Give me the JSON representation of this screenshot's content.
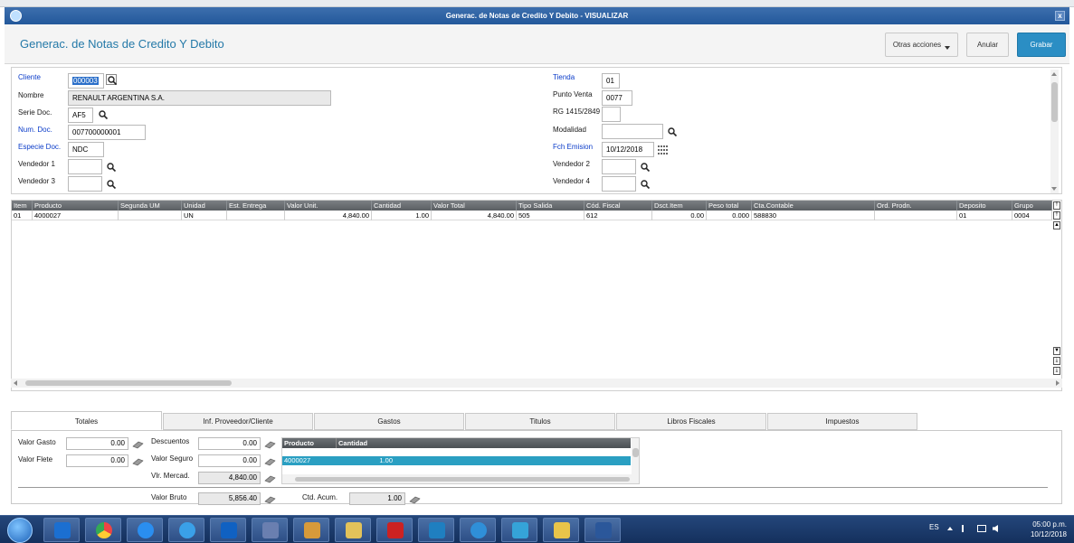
{
  "window": {
    "title": "Generac. de Notas de Credito Y Debito - VISUALIZAR",
    "close_label": "x"
  },
  "header": {
    "title": "Generac. de Notas de Credito Y Debito",
    "otras_acciones": "Otras acciones",
    "anular": "Anular",
    "grabar": "Grabar"
  },
  "form": {
    "cliente": {
      "label": "Cliente",
      "value": "000003"
    },
    "nombre": {
      "label": "Nombre",
      "value": "RENAULT ARGENTINA S.A."
    },
    "serie_doc": {
      "label": "Serie Doc.",
      "value": "AF5"
    },
    "num_doc": {
      "label": "Num. Doc.",
      "value": "007700000001"
    },
    "especie_doc": {
      "label": "Especie Doc.",
      "value": "NDC"
    },
    "vendedor1": {
      "label": "Vendedor 1",
      "value": ""
    },
    "vendedor3": {
      "label": "Vendedor 3",
      "value": ""
    },
    "tienda": {
      "label": "Tienda",
      "value": "01"
    },
    "punto_venta": {
      "label": "Punto Venta",
      "value": "0077"
    },
    "rg": {
      "label": "RG 1415/2849",
      "value": ""
    },
    "modalidad": {
      "label": "Modalidad",
      "value": ""
    },
    "fch_emision": {
      "label": "Fch Emision",
      "value": "10/12/2018"
    },
    "vendedor2": {
      "label": "Vendedor 2",
      "value": ""
    },
    "vendedor4": {
      "label": "Vendedor 4",
      "value": ""
    }
  },
  "grid": {
    "columns": [
      "Item",
      "Producto",
      "Segunda UM",
      "Unidad",
      "Est. Entrega",
      "Valor Unit.",
      "Cantidad",
      "Valor Total",
      "Tipo Salida",
      "Cód. Fiscal",
      "Dsct.Item",
      "Peso total",
      "Cta.Contable",
      "Ord. Prodn.",
      "Deposito",
      "Grupo"
    ],
    "rows": [
      {
        "item": "01",
        "producto": "4000027",
        "segunda_um": "",
        "unidad": "UN",
        "est_entrega": "",
        "valor_unit": "4,840.00",
        "cantidad": "1.00",
        "valor_total": "4,840.00",
        "tipo_salida": "505",
        "cod_fiscal": "612",
        "dsct_item": "0.00",
        "peso_total": "0.000",
        "cta_contable": "588830",
        "ord_prodn": "",
        "deposito": "01",
        "grupo": "0004"
      }
    ]
  },
  "tabs": [
    "Totales",
    "Inf. Proveedor/Cliente",
    "Gastos",
    "Titulos",
    "Libros Fiscales",
    "Impuestos"
  ],
  "totales": {
    "valor_gasto": {
      "label": "Valor Gasto",
      "value": "0.00"
    },
    "valor_flete": {
      "label": "Valor Flete",
      "value": "0.00"
    },
    "descuentos": {
      "label": "Descuentos",
      "value": "0.00"
    },
    "valor_seguro": {
      "label": "Valor Seguro",
      "value": "0.00"
    },
    "vlr_mercad": {
      "label": "Vlr. Mercad.",
      "value": "4,840.00"
    },
    "valor_bruto": {
      "label": "Valor Bruto",
      "value": "5,856.40"
    },
    "ctd_acum": {
      "label": "Ctd. Acum.",
      "value": "1.00"
    }
  },
  "mini_grid": {
    "columns": [
      "Producto",
      "Cantidad"
    ],
    "rows": [
      {
        "producto": "4000027",
        "cantidad": "1.00"
      }
    ]
  },
  "taskbar": {
    "lang": "ES",
    "time": "05:00 p.m.",
    "date": "10/12/2018"
  }
}
